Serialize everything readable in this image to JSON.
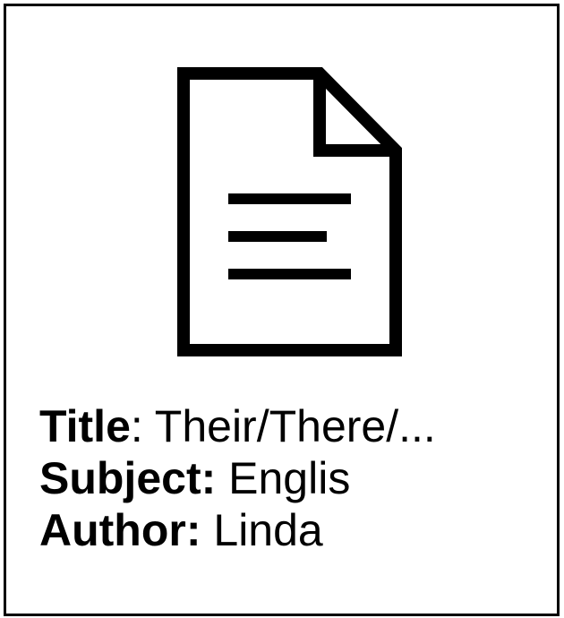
{
  "document": {
    "icon": "document-icon",
    "title_label": "Title",
    "title_sep": ": ",
    "title_value": "Their/There/...",
    "subject_label": "Subject:",
    "subject_value": " Englis",
    "author_label": "Author:",
    "author_value": " Linda"
  }
}
